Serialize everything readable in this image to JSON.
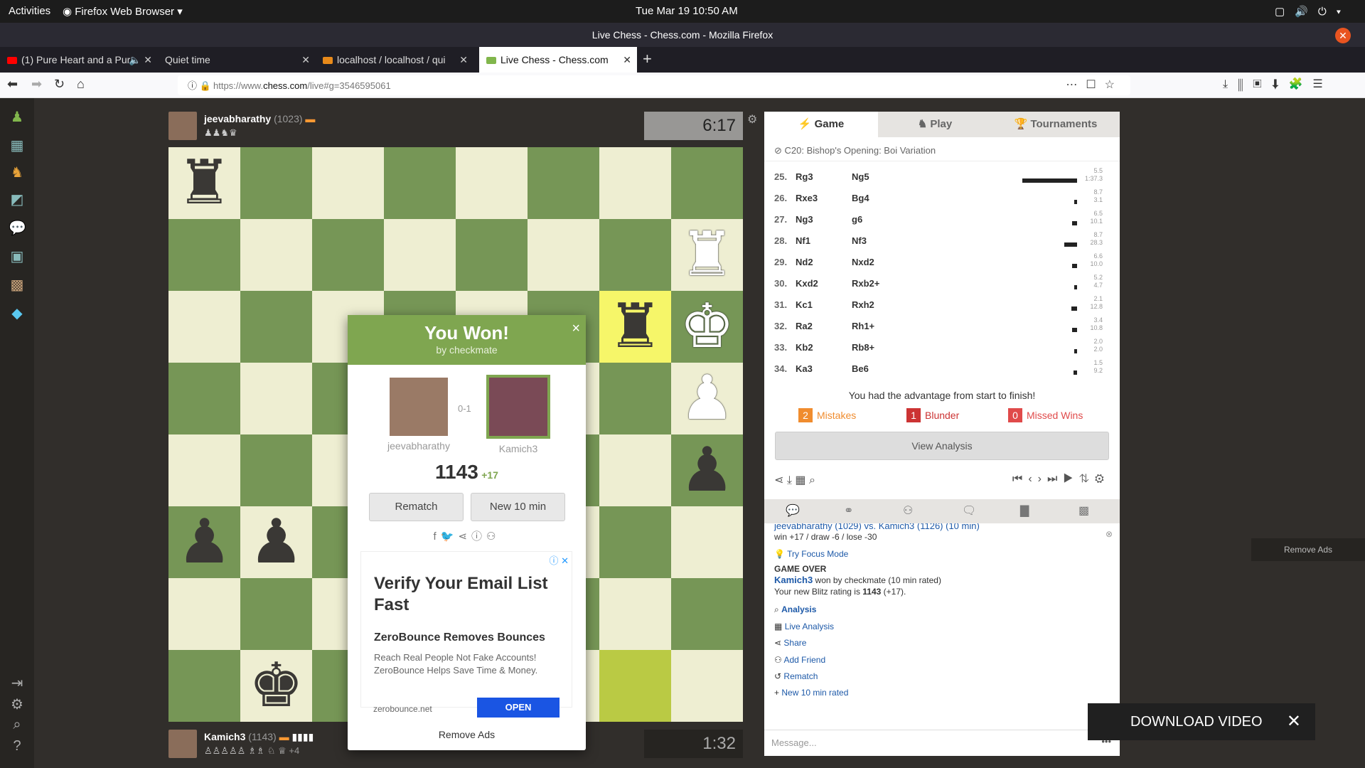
{
  "os": {
    "activities": "Activities",
    "app": "Firefox Web Browser",
    "clock": "Tue Mar 19  10:50 AM"
  },
  "window": {
    "title": "Live Chess - Chess.com - Mozilla Firefox"
  },
  "tabs": [
    {
      "label": "(1) Pure Heart and a Pur"
    },
    {
      "label": "Quiet time"
    },
    {
      "label": "localhost / localhost / qui"
    },
    {
      "label": "Live Chess - Chess.com"
    }
  ],
  "url": {
    "prefix": "https://www.",
    "domain": "chess.com",
    "path": "/live#g=3546595061"
  },
  "board": {
    "light": "#eeeed2",
    "dark": "#769656",
    "highlight": "#f6f669",
    "highlight_dark": "#baca44",
    "pieces": [
      {
        "sq": "a8",
        "p": "♜",
        "c": "b"
      },
      {
        "sq": "h7",
        "p": "♜",
        "c": "w"
      },
      {
        "sq": "g6",
        "p": "♜",
        "c": "b"
      },
      {
        "sq": "h6",
        "p": "♚",
        "c": "w"
      },
      {
        "sq": "h5",
        "p": "♟",
        "c": "w"
      },
      {
        "sq": "h4",
        "p": "♟",
        "c": "b"
      },
      {
        "sq": "a3",
        "p": "♟",
        "c": "b"
      },
      {
        "sq": "b3",
        "p": "♟",
        "c": "b"
      },
      {
        "sq": "b1",
        "p": "♚",
        "c": "b"
      }
    ]
  },
  "top_player": {
    "name": "jeevabharathy",
    "rating": "(1023)",
    "captured": "♟♟♞♛",
    "clock": "6:17"
  },
  "bottom_player": {
    "name": "Kamich3",
    "rating": "(1143)",
    "captured": "♙♙♙♙♙ ♗♗ ♘ ♕",
    "plus": "+4",
    "clock": "1:32"
  },
  "modal": {
    "title": "You Won!",
    "subtitle": "by checkmate",
    "close": "×",
    "p1": "jeevabharathy",
    "p2": "Kamich3",
    "score": "0-1",
    "rating": "1143",
    "delta": "+17",
    "rematch": "Rematch",
    "new": "New 10 min",
    "remove_ads": "Remove Ads"
  },
  "ad": {
    "headline": "Verify Your Email List Fast",
    "sub": "ZeroBounce Removes Bounces",
    "desc1": "Reach Real People Not Fake Accounts!",
    "desc2": "ZeroBounce Helps Save Time & Money.",
    "domain": "zerobounce.net",
    "cta": "OPEN"
  },
  "panel": {
    "tabs": [
      "Game",
      "Play",
      "Tournaments"
    ],
    "opening": "C20: Bishop's Opening: Boi Variation",
    "moves": [
      {
        "n": "25.",
        "w": "Rg3",
        "b": "Ng5",
        "t1": "5.5",
        "t2": "1:37.3",
        "bar": 0.7
      },
      {
        "n": "26.",
        "w": "Rxe3",
        "b": "Bg4",
        "t1": "8.7",
        "t2": "3.1",
        "bar": 0.02
      },
      {
        "n": "27.",
        "w": "Ng3",
        "b": "g6",
        "t1": "6.5",
        "t2": "10.1",
        "bar": 0.06
      },
      {
        "n": "28.",
        "w": "Nf1",
        "b": "Nf3",
        "t1": "8.7",
        "t2": "28.3",
        "bar": 0.16
      },
      {
        "n": "29.",
        "w": "Nd2",
        "b": "Nxd2",
        "t1": "6.6",
        "t2": "10.0",
        "bar": 0.06
      },
      {
        "n": "30.",
        "w": "Kxd2",
        "b": "Rxb2+",
        "t1": "5.2",
        "t2": "4.7",
        "bar": 0.02
      },
      {
        "n": "31.",
        "w": "Kc1",
        "b": "Rxh2",
        "t1": "2.1",
        "t2": "12.8",
        "bar": 0.07
      },
      {
        "n": "32.",
        "w": "Ra2",
        "b": "Rh1+",
        "t1": "3.4",
        "t2": "10.8",
        "bar": 0.06
      },
      {
        "n": "33.",
        "w": "Kb2",
        "b": "Rb8+",
        "t1": "2.0",
        "t2": "2.0",
        "bar": 0.01
      },
      {
        "n": "34.",
        "w": "Ka3",
        "b": "Be6",
        "t1": "1.5",
        "t2": "9.2",
        "bar": 0.05
      }
    ],
    "advantage": "You had the advantage from start to finish!",
    "mistakes": {
      "count": "2",
      "label": "Mistakes"
    },
    "blunder": {
      "count": "1",
      "label": "Blunder"
    },
    "missed": {
      "count": "0",
      "label": "Missed Wins"
    },
    "view_analysis": "View Analysis"
  },
  "chat": {
    "header": "jeevabharathy (1029) vs. Kamich3 (1126) (10 min)",
    "odds": "win +17 / draw -6 / lose -30",
    "focus": "Try Focus Mode",
    "over": "GAME OVER",
    "winner": "Kamich3",
    "winner_text": " won by checkmate (10 min rated)",
    "rating_text": "Your new Blitz rating is ",
    "rating_val": "1143",
    "rating_delta": " (+17).",
    "links": [
      "Analysis",
      "Live Analysis",
      "Share",
      "Add Friend",
      "Rematch",
      "New 10 min rated"
    ],
    "placeholder": "Message..."
  },
  "remove_ads": "Remove Ads",
  "download_video": "DOWNLOAD VIDEO"
}
